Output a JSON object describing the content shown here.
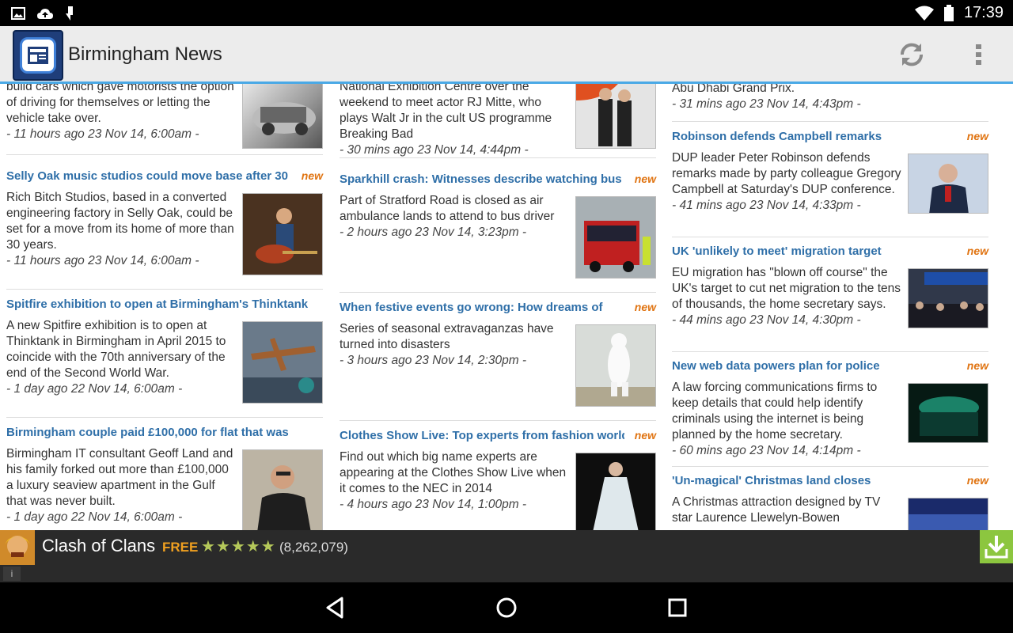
{
  "status_bar": {
    "time": "17:39",
    "left_icons": [
      "image-icon",
      "cloud-upload-icon",
      "usb-debug-icon"
    ],
    "right_icons": [
      "wifi-icon",
      "battery-icon"
    ]
  },
  "app_bar": {
    "title": "Birmingham News",
    "icon_label": "NEWS",
    "actions": [
      "refresh-icon",
      "overflow-menu-icon"
    ]
  },
  "columns": [
    {
      "articles": [
        {
          "title": "",
          "summary": "build cars which gave motorists the option of driving for themselves or letting the vehicle take over.",
          "meta": "- 11 hours ago 23 Nov 14, 6:00am -",
          "is_new": false,
          "thumb": "car-interior"
        },
        {
          "title": "Selly Oak music studios could move base after 30",
          "summary": "Rich Bitch Studios, based in a converted engineering factory in Selly Oak, could be set for a move from its home of more than 30 years.",
          "meta": "- 11 hours ago 23 Nov 14, 6:00am -",
          "is_new": true,
          "thumb": "guitarist"
        },
        {
          "title": "Spitfire exhibition to open at Birmingham's Thinktank",
          "summary": "A new Spitfire exhibition is to open at Thinktank in Birmingham in April 2015 to coincide with the 70th anniversary of the end of the Second World War.",
          "meta": "- 1 day ago 22 Nov 14, 6:00am -",
          "is_new": false,
          "thumb": "spitfire-museum"
        },
        {
          "title": "Birmingham couple paid £100,000 for flat that was",
          "summary": "Birmingham IT consultant Geoff Land and his family forked out more than £100,000 a luxury seaview apartment in the Gulf that was never built.",
          "meta": "- 1 day ago 22 Nov 14, 6:00am -",
          "is_new": false,
          "thumb": "man-portrait"
        }
      ]
    },
    {
      "articles": [
        {
          "title": "",
          "summary": "National Exhibition Centre over the weekend to meet actor RJ Mitte, who plays Walt Jr in the cult US programme Breaking Bad",
          "meta": "- 30 mins ago 23 Nov 14, 4:44pm -",
          "is_new": false,
          "thumb": "umbrella-girls"
        },
        {
          "title": "Sparkhill crash: Witnesses describe watching bus",
          "summary": "Part of Stratford Road is closed as air ambulance lands to attend to bus driver",
          "meta": "- 2 hours ago 23 Nov 14, 3:23pm -",
          "is_new": true,
          "thumb": "crashed-bus"
        },
        {
          "title": "When festive events go wrong: How dreams of",
          "summary": "Series of seasonal extravaganzas have turned into disasters",
          "meta": "- 3 hours ago 23 Nov 14, 2:30pm -",
          "is_new": true,
          "thumb": "polar-bear"
        },
        {
          "title": "Clothes Show Live: Top experts from fashion world",
          "summary": "Find out which big name experts are appearing at the Clothes Show Live when it comes to the NEC in 2014",
          "meta": "- 4 hours ago 23 Nov 14, 1:00pm -",
          "is_new": true,
          "thumb": "fashion-model"
        }
      ]
    },
    {
      "articles": [
        {
          "title": "",
          "summary": "Abu Dhabi Grand Prix.",
          "meta": "- 31 mins ago 23 Nov 14, 4:43pm -",
          "is_new": false,
          "thumb": ""
        },
        {
          "title": "Robinson defends Campbell remarks",
          "summary": "DUP leader Peter Robinson defends remarks made by party colleague Gregory Campbell at Saturday's DUP conference.",
          "meta": "- 41 mins ago 23 Nov 14, 4:33pm -",
          "is_new": true,
          "thumb": "speaker-podium"
        },
        {
          "title": "UK 'unlikely to meet' migration target",
          "summary": "EU migration has \"blown off course\" the UK's target to cut net migration to the tens of thousands, the home secretary says.",
          "meta": "- 44 mins ago 23 Nov 14, 4:30pm -",
          "is_new": true,
          "thumb": "passport-control"
        },
        {
          "title": "New web data powers plan for police",
          "summary": "A law forcing communications firms to keep details that could help identify criminals using the internet is being planned by the home secretary.",
          "meta": "- 60 mins ago 23 Nov 14, 4:14pm -",
          "is_new": true,
          "thumb": "keyboard-glow"
        },
        {
          "title": "'Un-magical' Christmas land closes",
          "summary": "A Christmas attraction designed by TV star Laurence Llewelyn-Bowen",
          "meta": "",
          "is_new": true,
          "thumb": "christmas-land"
        }
      ]
    }
  ],
  "new_label": "new",
  "ad": {
    "title": "Clash of Clans",
    "price": "FREE",
    "stars": "★★★★★",
    "rating_count": "(8,262,079)",
    "info": "i"
  },
  "nav": [
    "back-icon",
    "home-icon",
    "recents-icon"
  ],
  "colors": {
    "accent_blue": "#4aa9e6",
    "title_blue": "#2f6fa8",
    "new_orange": "#e07412",
    "ad_green": "#8cc63f"
  }
}
